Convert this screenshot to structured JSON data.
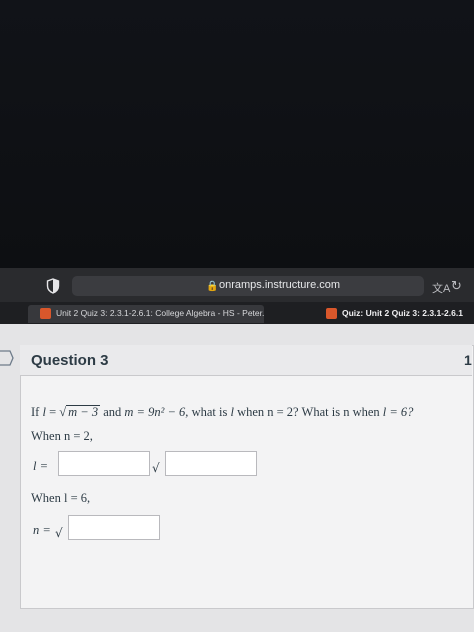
{
  "browser": {
    "url": "onramps.instructure.com",
    "tabs": [
      {
        "label": "Unit 2 Quiz 3: 2.3.1-2.6.1: College Algebra - HS - Peter..."
      },
      {
        "label": "Quiz: Unit 2 Quiz 3: 2.3.1-2.6.1"
      }
    ],
    "icons": [
      "shield-icon",
      "lock-icon",
      "translate-icon",
      "reload-icon"
    ]
  },
  "question": {
    "title": "Question 3",
    "points_partial": "1",
    "prompt": {
      "if": "If",
      "l_var": "l",
      "eq": "=",
      "radicand": "m − 3",
      "and": "and",
      "m_eq": "m = 9n² − 6,",
      "what_is": "what is",
      "when_n2": "when n = 2?",
      "what_is_n": "What is n when",
      "l_eq6": "l = 6?"
    },
    "part1_label": "When n = 2,",
    "part1_var": "l =",
    "part2_label": "When l = 6,",
    "part2_var": "n =",
    "sqrt_symbol": "√"
  }
}
